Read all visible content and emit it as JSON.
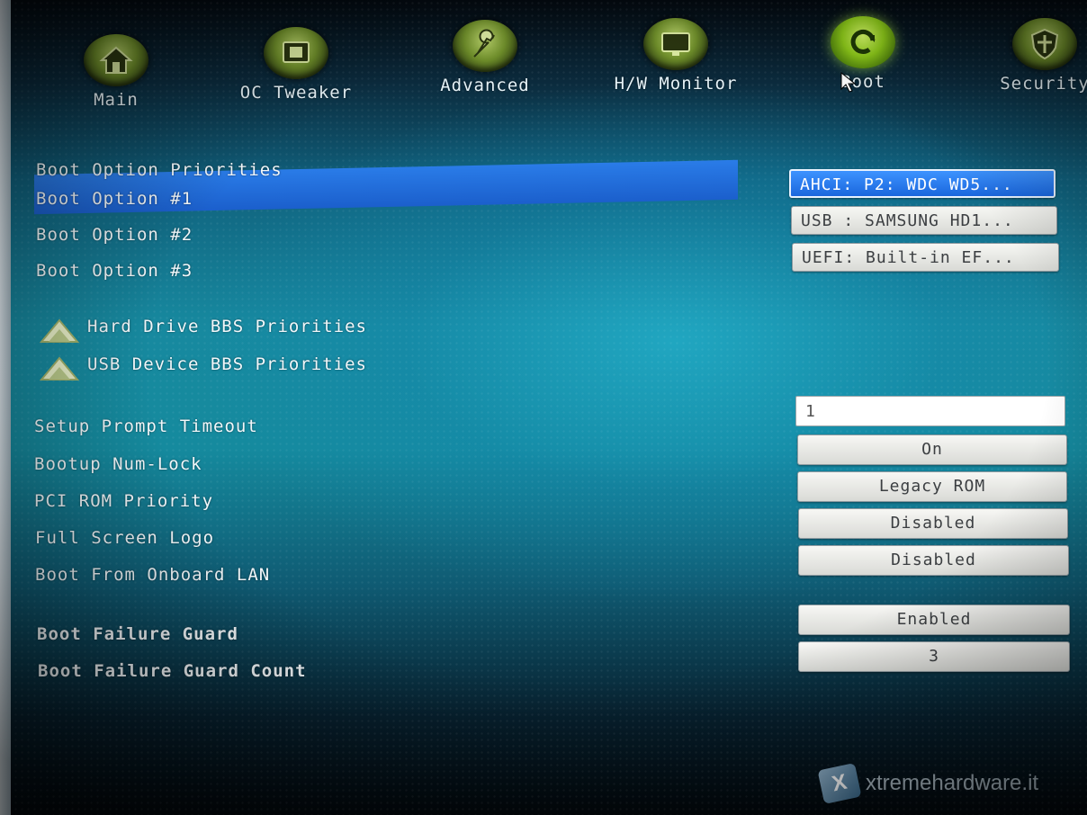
{
  "nav": {
    "tabs": [
      {
        "label": "Main",
        "icon": "home-icon"
      },
      {
        "label": "OC Tweaker",
        "icon": "monitor-chip-icon"
      },
      {
        "label": "Advanced",
        "icon": "wrench-icon"
      },
      {
        "label": "H/W Monitor",
        "icon": "monitor-icon"
      },
      {
        "label": "Boot",
        "icon": "refresh-icon"
      },
      {
        "label": "Security",
        "icon": "shield-icon"
      }
    ],
    "active": "Boot"
  },
  "boot": {
    "priorities_heading": "Boot Option Priorities",
    "options": [
      {
        "label": "Boot Option #1",
        "value": "AHCI: P2: WDC WD5..."
      },
      {
        "label": "Boot Option #2",
        "value": "USB : SAMSUNG HD1..."
      },
      {
        "label": "Boot Option #3",
        "value": "UEFI: Built-in EF..."
      }
    ],
    "submenus": [
      {
        "label": "Hard Drive BBS Priorities"
      },
      {
        "label": "USB Device BBS Priorities"
      }
    ],
    "settings": [
      {
        "label": "Setup Prompt Timeout",
        "value": "1"
      },
      {
        "label": "Bootup Num-Lock",
        "value": "On"
      },
      {
        "label": "PCI ROM Priority",
        "value": "Legacy ROM"
      },
      {
        "label": "Full Screen Logo",
        "value": "Disabled"
      },
      {
        "label": "Boot From Onboard LAN",
        "value": "Disabled"
      },
      {
        "label": "Boot Failure Guard",
        "value": "Enabled"
      },
      {
        "label": "Boot Failure Guard Count",
        "value": "3"
      }
    ]
  },
  "watermark": {
    "text": "xtremehardware.it",
    "logo_letter": "X"
  },
  "colors": {
    "highlight": "#1b5fcc",
    "icon_green": "#8fcc1a",
    "text": "#f2f7fa",
    "field_bg": "#e8e9e5"
  }
}
